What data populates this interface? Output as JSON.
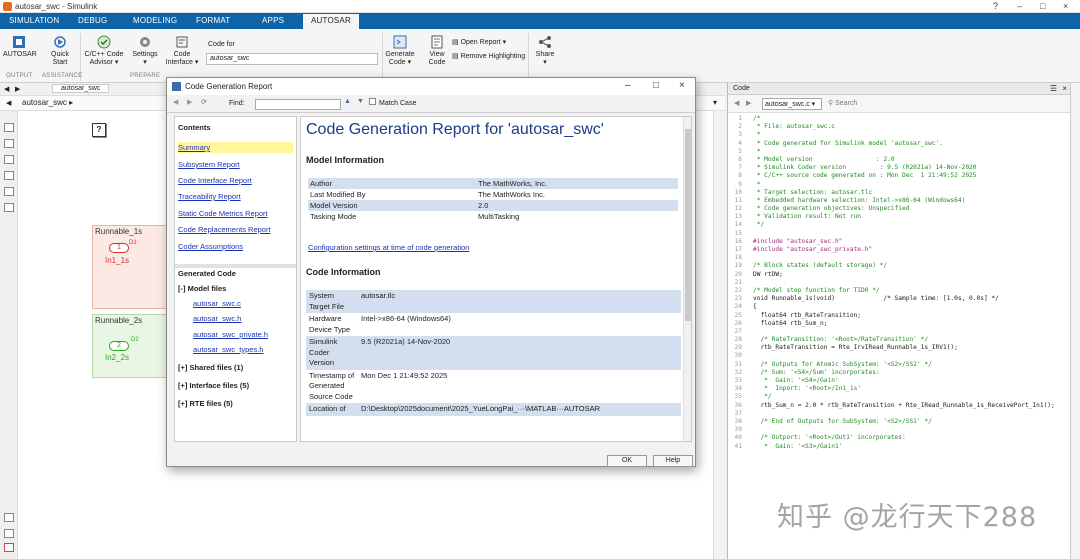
{
  "window": {
    "title": "autosar_swc - Simulink"
  },
  "tabs": [
    "SIMULATION",
    "DEBUG",
    "MODELING",
    "FORMAT",
    "APPS",
    "AUTOSAR"
  ],
  "ribbon": {
    "autosar_btn": "AUTOSAR",
    "quick_start": [
      "Quick",
      "Start"
    ],
    "cc_advisor": [
      "C/C++ Code",
      "Advisor ▾"
    ],
    "settings": [
      "Settings",
      "▾"
    ],
    "code_interface": [
      "Code",
      "Interface ▾"
    ],
    "code_for_label": "Code for",
    "code_for_value": "autosar_swc",
    "generate_code": [
      "Generate",
      "Code ▾"
    ],
    "view_code": [
      "View",
      "Code"
    ],
    "open_report": "Open Report ▾",
    "remove_highlighting": "Remove Highlighting",
    "share": [
      "Share",
      "▾"
    ],
    "groups": {
      "output": "OUTPUT",
      "assistance": "ASSISTANCE",
      "prepare": "PREPARE"
    }
  },
  "editor": {
    "nav_tab": "autosar_swc",
    "breadcrumb": "autosar_swc ▸",
    "blocks": {
      "runnable1": "Runnable_1s",
      "runnable2": "Runnable_2s",
      "port1_num": "1",
      "port1_sig": "D1",
      "port1_name": "In1_1s",
      "port2_num": "2",
      "port2_sig": "D2",
      "port2_name": "In2_2s",
      "help_block": "?"
    }
  },
  "code_panel": {
    "header": "Code",
    "file_select": "autosar_swc.c ▾",
    "search_placeholder": "Search",
    "lines": [
      {
        "n": "1",
        "t": "/*",
        "k": "cm"
      },
      {
        "n": "2",
        "t": " * File: autosar_swc.c",
        "k": "cm"
      },
      {
        "n": "3",
        "t": " *",
        "k": "cm"
      },
      {
        "n": "4",
        "t": " * Code generated for Simulink model 'autosar_swc'.",
        "k": "cm"
      },
      {
        "n": "5",
        "t": " *",
        "k": "cm"
      },
      {
        "n": "6",
        "t": " * Model version                 : 2.0",
        "k": "cm"
      },
      {
        "n": "7",
        "t": " * Simulink Coder version         : 9.5 (R2021a) 14-Nov-2020",
        "k": "cm"
      },
      {
        "n": "8",
        "t": " * C/C++ source code generated on : Mon Dec  1 21:49:52 2025",
        "k": "cm"
      },
      {
        "n": "9",
        "t": " *",
        "k": "cm"
      },
      {
        "n": "10",
        "t": " * Target selection: autosar.tlc",
        "k": "cm"
      },
      {
        "n": "11",
        "t": " * Embedded hardware selection: Intel->x86-64 (Windows64)",
        "k": "cm"
      },
      {
        "n": "12",
        "t": " * Code generation objectives: Unspecified",
        "k": "cm"
      },
      {
        "n": "13",
        "t": " * Validation result: Not run",
        "k": "cm"
      },
      {
        "n": "14",
        "t": " */",
        "k": "cm"
      },
      {
        "n": "15",
        "t": "",
        "k": "bl"
      },
      {
        "n": "16",
        "t": "#include \"autosar_swc.h\"",
        "k": "pp"
      },
      {
        "n": "17",
        "t": "#include \"autosar_swc_private.h\"",
        "k": "pp"
      },
      {
        "n": "18",
        "t": "",
        "k": "bl"
      },
      {
        "n": "19",
        "t": "/* Block states (default storage) */",
        "k": "cm"
      },
      {
        "n": "20",
        "t": "DW rtDW;",
        "k": "code"
      },
      {
        "n": "21",
        "t": "",
        "k": "bl"
      },
      {
        "n": "22",
        "t": "/* Model step function for TID0 */",
        "k": "cm"
      },
      {
        "n": "23",
        "t": "void Runnable_1s(void)             /* Sample time: [1.0s, 0.0s] */",
        "k": "code"
      },
      {
        "n": "24",
        "t": "{",
        "k": "code"
      },
      {
        "n": "25",
        "t": "  float64 rtb_RateTransition;",
        "k": "code"
      },
      {
        "n": "26",
        "t": "  float64 rtb_Sum_n;",
        "k": "code"
      },
      {
        "n": "27",
        "t": "",
        "k": "bl"
      },
      {
        "n": "28",
        "t": "  /* RateTransition: '<Root>/RateTransition' */",
        "k": "cm"
      },
      {
        "n": "29",
        "t": "  rtb_RateTransition = Rte_IrvIRead_Runnable_1s_IRV1();",
        "k": "code"
      },
      {
        "n": "30",
        "t": "",
        "k": "bl"
      },
      {
        "n": "31",
        "t": "  /* Outputs for Atomic SubSystem: '<S2>/SS2' */",
        "k": "cm"
      },
      {
        "n": "32",
        "t": "  /* Sum: '<S4>/Sum' incorporates:",
        "k": "cm"
      },
      {
        "n": "33",
        "t": "   *  Gain: '<S4>/Gain'",
        "k": "cm"
      },
      {
        "n": "34",
        "t": "   *  Inport: '<Root>/In1_1s'",
        "k": "cm"
      },
      {
        "n": "35",
        "t": "   */",
        "k": "cm"
      },
      {
        "n": "36",
        "t": "  rtb_Sum_n = 2.0 * rtb_RateTransition + Rte_IRead_Runnable_1s_ReceivePort_In1();",
        "k": "code"
      },
      {
        "n": "37",
        "t": "",
        "k": "bl"
      },
      {
        "n": "38",
        "t": "  /* End of Outputs for SubSystem: '<S2>/SS1' */",
        "k": "cm"
      },
      {
        "n": "39",
        "t": "",
        "k": "bl"
      },
      {
        "n": "40",
        "t": "  /* Outport: '<Root>/Out1' incorporates:",
        "k": "cm"
      },
      {
        "n": "41",
        "t": "   *  Gain: '<S3>/Gain1'",
        "k": "cm"
      }
    ]
  },
  "report": {
    "title": "Code Generation Report",
    "find_label": "Find:",
    "match_case": "Match Case",
    "contents_heading": "Contents",
    "nav": [
      "Summary",
      "Subsystem Report",
      "Code Interface Report",
      "Traceability Report",
      "Static Code Metrics Report",
      "Code Replacements Report",
      "Coder Assumptions"
    ],
    "generated_code_heading": "Generated Code",
    "model_files_label": "[-]  Model files",
    "files": [
      "autosar_swc.c",
      "autosar_swc.h",
      "autosar_swc_private.h",
      "autosar_swc_types.h"
    ],
    "shared_files": "[+]  Shared files (1)",
    "interface_files": "[+]  Interface files (5)",
    "rte_files": "[+]  RTE files (5)",
    "heading": "Code Generation Report for 'autosar_swc'",
    "model_info_heading": "Model Information",
    "model_info": [
      {
        "k": "Author",
        "v": "The MathWorks, Inc."
      },
      {
        "k": "Last Modified By",
        "v": "The MathWorks Inc."
      },
      {
        "k": "Model Version",
        "v": "2.0"
      },
      {
        "k": "Tasking Mode",
        "v": "MultiTasking"
      }
    ],
    "config_link": "Configuration settings at time of code generation",
    "code_info_heading": "Code Information",
    "code_info": [
      {
        "k": "System Target File",
        "v": "autosar.tlc"
      },
      {
        "k": "Hardware Device Type",
        "v": "Intel->x86-64 (Windows64)"
      },
      {
        "k": "Simulink Coder Version",
        "v": "9.5 (R2021a) 14-Nov-2020"
      },
      {
        "k": "Timestamp of Generated Source Code",
        "v": "Mon Dec 1 21:49:52 2025"
      },
      {
        "k": "Location of",
        "v": "D:\\Desktop\\2025document\\2025_YueLongPai_···\\MATLAB···AUTOSAR"
      }
    ],
    "ok_btn": "OK",
    "help_btn": "Help"
  },
  "watermark": "知乎 @龙行天下288",
  "colors": {
    "tab_strip": "#0d64a8",
    "link": "#1a33b5",
    "heading": "#1b3c89",
    "row_shade": "#d3dfee",
    "summary_hl": "#fff79a"
  }
}
